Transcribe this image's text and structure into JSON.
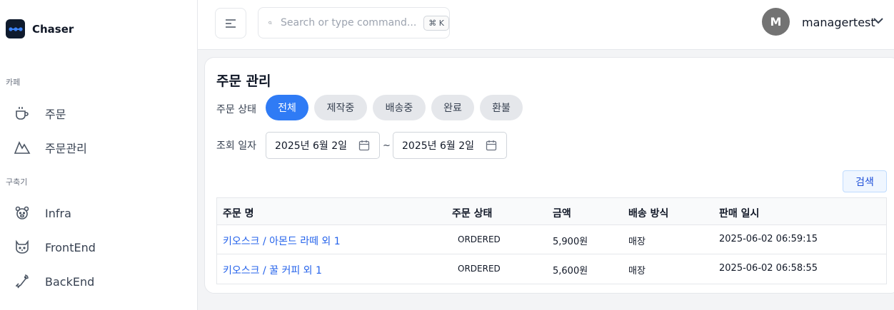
{
  "brand": {
    "name": "Chaser"
  },
  "sidebar": {
    "sections": [
      {
        "label": "카페",
        "items": [
          {
            "label": "주문",
            "icon": "coffee-cup-icon"
          },
          {
            "label": "주문관리",
            "icon": "mountain-icon"
          }
        ]
      },
      {
        "label": "구축기",
        "items": [
          {
            "label": "Infra",
            "icon": "bear-icon"
          },
          {
            "label": "FrontEnd",
            "icon": "cat-icon"
          },
          {
            "label": "BackEnd",
            "icon": "bird-icon"
          }
        ]
      }
    ]
  },
  "header": {
    "search_placeholder": "Search or type command...",
    "shortcut": "⌘ K",
    "user": {
      "initial": "M",
      "name": "managertest"
    }
  },
  "main": {
    "title": "주문 관리",
    "status_label": "주문 상태",
    "statuses": [
      "전체",
      "제작중",
      "배송중",
      "완료",
      "환불"
    ],
    "active_status": "전체",
    "date_label": "조회 일자",
    "date_from": "2025년 6월 2일",
    "date_sep": "~",
    "date_to": "2025년 6월 2일",
    "search_button": "검색",
    "table": {
      "columns": [
        "주문 명",
        "주문 상태",
        "금액",
        "배송 방식",
        "판매 일시"
      ],
      "rows": [
        [
          "키오스크 / 아몬드 라떼 외 1",
          "ORDERED",
          "5,900원",
          "매장",
          "2025-06-02 06:59:15"
        ],
        [
          "키오스크 / 꿀 커피 외 1",
          "ORDERED",
          "5,600원",
          "매장",
          "2025-06-02 06:58:55"
        ]
      ]
    }
  },
  "colors": {
    "accent": "#2f7bf5",
    "logo_bg": "#0f1b2d",
    "link": "#2563eb"
  }
}
